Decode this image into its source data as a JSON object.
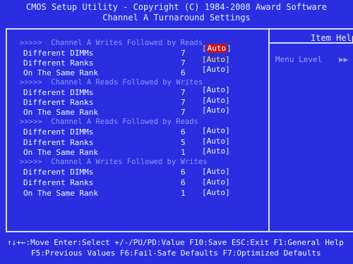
{
  "header": {
    "title": "CMOS Setup Utility - Copyright (C) 1984-2008 Award Software",
    "subtitle": "Channel A Turnaround Settings"
  },
  "help_panel": {
    "title": "Item Help",
    "menu_level_label": "Menu Level",
    "menu_level_arrows": "▶▶"
  },
  "sections": [
    {
      "heading": "Channel A Writes Followed by Reads",
      "rows": [
        {
          "label": "Different DIMMs",
          "number": "7",
          "value": "Auto"
        },
        {
          "label": "Different Ranks",
          "number": "7",
          "value": "Auto"
        },
        {
          "label": "On The Same Rank",
          "number": "6",
          "value": "Auto"
        }
      ]
    },
    {
      "heading": "Channel A Reads Followed by Writes",
      "rows": [
        {
          "label": "Different DIMMs",
          "number": "7",
          "value": "Auto"
        },
        {
          "label": "Different Ranks",
          "number": "7",
          "value": "Auto"
        },
        {
          "label": "On The Same Rank",
          "number": "7",
          "value": "Auto"
        }
      ]
    },
    {
      "heading": "Channel A Reads Followed by Reads",
      "rows": [
        {
          "label": "Different DIMMs",
          "number": "6",
          "value": "Auto"
        },
        {
          "label": "Different Ranks",
          "number": "5",
          "value": "Auto"
        },
        {
          "label": "On The Same Rank",
          "number": "1",
          "value": "Auto"
        }
      ]
    },
    {
      "heading": "Channel A Writes Followed by Writes",
      "rows": [
        {
          "label": "Different DIMMs",
          "number": "6",
          "value": "Auto"
        },
        {
          "label": "Different Ranks",
          "number": "6",
          "value": "Auto"
        },
        {
          "label": "On The Same Rank",
          "number": "1",
          "value": "Auto"
        }
      ]
    }
  ],
  "bottom_bar": {
    "line1": "↑↓+←:Move   Enter:Select   +/-/PU/PD:Value   F10:Save   ESC:Exit   F1:General Help",
    "line2": "F5:Previous Values   F6:Fail-Safe Defaults   F7:Optimized Defaults"
  },
  "colors": {
    "background": "#2a2ee0",
    "text": "#f4f6ff",
    "section_header": "#8f95ff",
    "yellow_value": "#f4f062",
    "selected_highlight": "#c6161c"
  }
}
